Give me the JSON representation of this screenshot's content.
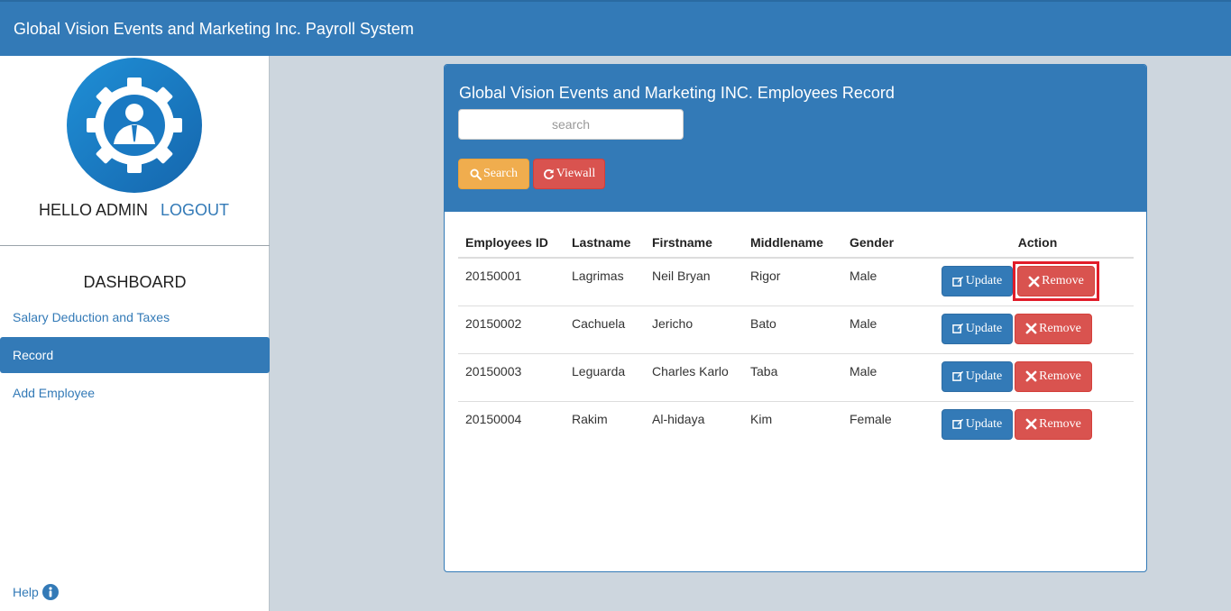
{
  "header": {
    "title": "Global Vision Events and Marketing Inc. Payroll System"
  },
  "sidebar": {
    "hello": "HELLO ADMIN",
    "logout": "LOGOUT",
    "dashboard": "DASHBOARD",
    "items": [
      {
        "label": "Salary Deduction and Taxes"
      },
      {
        "label": "Record"
      },
      {
        "label": "Add Employee"
      }
    ],
    "help": "Help"
  },
  "panel": {
    "title": "Global Vision Events and Marketing INC. Employees Record",
    "search_placeholder": "search",
    "search_button": "Search",
    "viewall_button": "Viewall"
  },
  "table": {
    "columns": [
      "Employees ID",
      "Lastname",
      "Firstname",
      "Middlename",
      "Gender",
      "Action"
    ],
    "rows": [
      {
        "id": "20150001",
        "lastname": "Lagrimas",
        "firstname": "Neil Bryan",
        "middlename": "Rigor",
        "gender": "Male"
      },
      {
        "id": "20150002",
        "lastname": "Cachuela",
        "firstname": "Jericho",
        "middlename": "Bato",
        "gender": "Male"
      },
      {
        "id": "20150003",
        "lastname": "Leguarda",
        "firstname": "Charles Karlo",
        "middlename": "Taba",
        "gender": "Male"
      },
      {
        "id": "20150004",
        "lastname": "Rakim",
        "firstname": "Al-hidaya",
        "middlename": "Kim",
        "gender": "Female"
      }
    ],
    "update_label": "Update",
    "remove_label": "Remove"
  },
  "colors": {
    "primary": "#337ab7",
    "warning": "#f0ad4e",
    "danger": "#d9534f",
    "highlight": "#e11d2a"
  }
}
